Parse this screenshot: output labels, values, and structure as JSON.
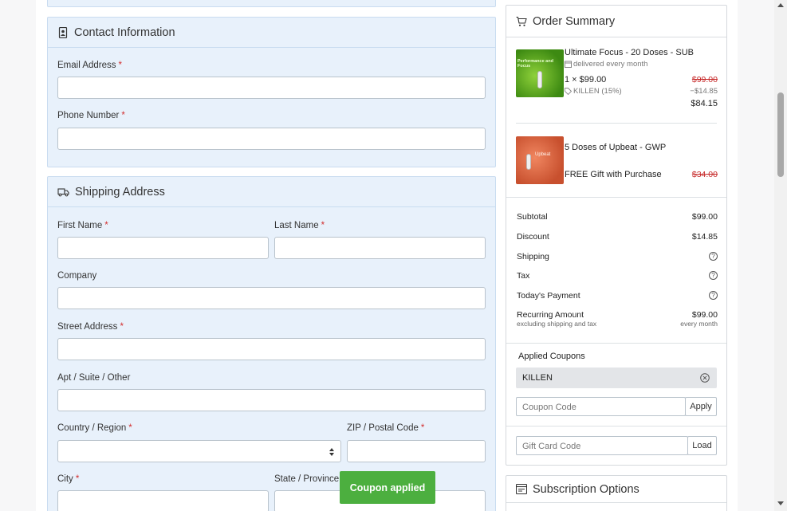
{
  "contact": {
    "title": "Contact Information",
    "email_label": "Email Address",
    "phone_label": "Phone Number",
    "required_mark": "*"
  },
  "shipping": {
    "title": "Shipping Address",
    "first_name_label": "First Name",
    "last_name_label": "Last Name",
    "company_label": "Company",
    "street_label": "Street Address",
    "apt_label": "Apt / Suite / Other",
    "country_label": "Country / Region",
    "zip_label": "ZIP / Postal Code",
    "city_label": "City",
    "state_label": "State / Province"
  },
  "summary": {
    "title": "Order Summary",
    "items": [
      {
        "name": "Ultimate Focus - 20 Doses - SUB",
        "frequency": "delivered every month",
        "qty_price": "1 × $99.00",
        "coupon_note": "KILLEN (15%)",
        "original_price": "$99.00",
        "discount": "−$14.85",
        "final_price": "$84.15",
        "image_text": "Performance and Focus"
      },
      {
        "name": "5 Doses of Upbeat - GWP",
        "gift_note": "FREE Gift with Purchase",
        "original_price": "$34.00",
        "image_text": "Upbeat"
      }
    ],
    "totals": {
      "subtotal_label": "Subtotal",
      "subtotal_value": "$99.00",
      "discount_label": "Discount",
      "discount_value": "$14.85",
      "shipping_label": "Shipping",
      "tax_label": "Tax",
      "today_label": "Today's Payment",
      "recurring_label": "Recurring Amount",
      "recurring_sub": "excluding shipping and tax",
      "recurring_value": "$99.00",
      "recurring_period": "every month",
      "help_glyph": "?"
    },
    "coupons": {
      "title": "Applied Coupons",
      "applied_code": "KILLEN",
      "coupon_placeholder": "Coupon Code",
      "apply_label": "Apply",
      "giftcard_placeholder": "Gift Card Code",
      "load_label": "Load"
    }
  },
  "subscription": {
    "title": "Subscription Options"
  },
  "toast": {
    "message": "Coupon applied"
  },
  "colors": {
    "panel_bg": "#e8f1fb",
    "required": "#d32f2f",
    "strike": "#c62828",
    "toast": "#4caf3f"
  }
}
